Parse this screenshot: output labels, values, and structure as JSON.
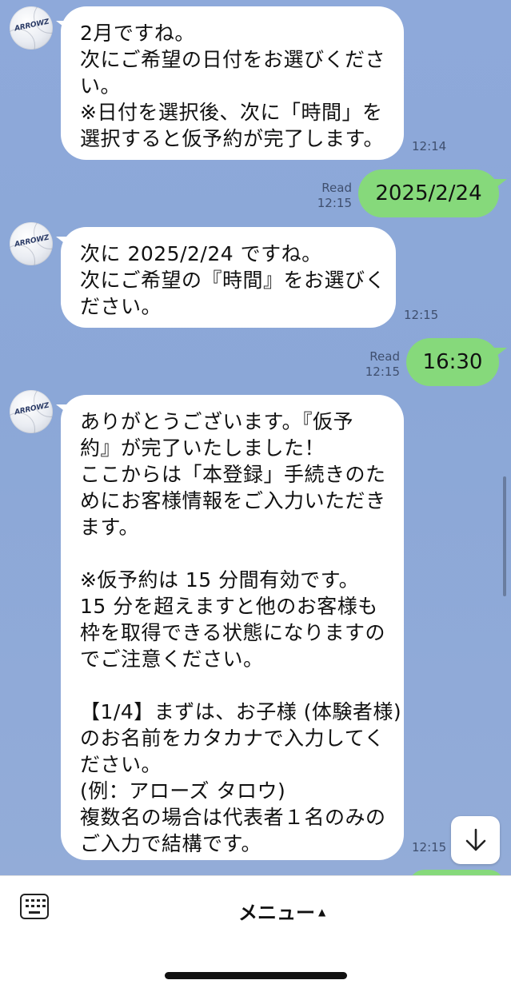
{
  "chat": {
    "messages": [
      {
        "type": "incoming",
        "text": "2月ですね。\n次にご希望の日付をお選びくださ\nい。\n※日付を選択後、次に「時間」を\n選択すると仮予約が完了します。",
        "time": "12:14"
      },
      {
        "type": "outgoing",
        "text": "2025/2/24",
        "read": "Read",
        "time": "12:15"
      },
      {
        "type": "incoming",
        "text": "次に 2025/2/24 ですね。\n次にご希望の『時間』をお選びく\nださい。",
        "time": "12:15"
      },
      {
        "type": "outgoing",
        "text": "16:30",
        "read": "Read",
        "time": "12:15"
      },
      {
        "type": "incoming",
        "text": "ありがとうございます。『仮予\n約』が完了いたしました！\nここからは「本登録」手続きのた\nめにお客様情報をご入力いただき\nます。\n\n※仮予約は 15 分間有効です。\n15 分を超えますと他のお客様も\n枠を取得できる状態になりますの\nでご注意ください。\n\n【1/4】まずは、お子様 (体験者様)\nのお名前をカタカナで入力してく\nださい。\n(例：アローズ タロウ)\n複数名の場合は代表者１名のみの\nご入力で結構です。",
        "time": "12:15"
      }
    ],
    "avatar_label": "ARROWZ"
  },
  "footer": {
    "menu_label": "メニュー",
    "menu_arrow": "▲",
    "keyboard_icon": "keyboard-icon",
    "scroll_icon": "arrow-down-icon"
  },
  "colors": {
    "background": "#8ea9da",
    "incoming_bubble": "#ffffff",
    "outgoing_bubble": "#86d97b"
  }
}
